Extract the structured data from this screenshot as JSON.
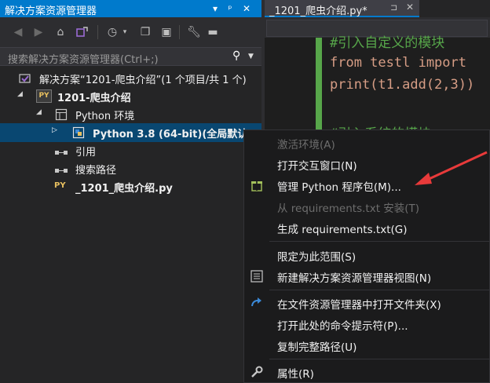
{
  "solution_explorer": {
    "title": "解决方案资源管理器",
    "search_placeholder": "搜索解决方案资源管理器(Ctrl+;)",
    "tree": [
      {
        "label": "解决方案“1201-爬虫介绍”(1 个项目/共 1 个)"
      },
      {
        "label": "1201-爬虫介绍"
      },
      {
        "label": "Python 环境"
      },
      {
        "label": "Python 3.8 (64-bit)(全局默认)"
      },
      {
        "label": "引用"
      },
      {
        "label": "搜索路径"
      },
      {
        "label": "_1201_爬虫介绍.py"
      }
    ]
  },
  "editor": {
    "tab_name": "_1201_爬虫介绍.py*",
    "lines": [
      {
        "text": "#引入自定义的模块"
      },
      {
        "text": "from testl import"
      },
      {
        "text": "print(t1.add(2,3))"
      },
      {
        "text": "#引入系统的模块"
      }
    ]
  },
  "context_menu": {
    "items": [
      {
        "label": "激活环境(A)",
        "disabled": true
      },
      {
        "label": "打开交互窗口(N)"
      },
      {
        "label": "管理 Python 程序包(M)..."
      },
      {
        "label": "从 requirements.txt 安装(T)",
        "disabled": true
      },
      {
        "label": "生成 requirements.txt(G)"
      },
      {
        "label": "限定为此范围(S)"
      },
      {
        "label": "新建解决方案资源管理器视图(N)"
      },
      {
        "label": "在文件资源管理器中打开文件夹(X)"
      },
      {
        "label": "打开此处的命令提示符(P)..."
      },
      {
        "label": "复制完整路径(U)"
      },
      {
        "label": "属性(R)"
      }
    ]
  },
  "colors": {
    "accent": "#007acc",
    "selection": "#094771",
    "annotation_arrow": "#e83a3a"
  }
}
